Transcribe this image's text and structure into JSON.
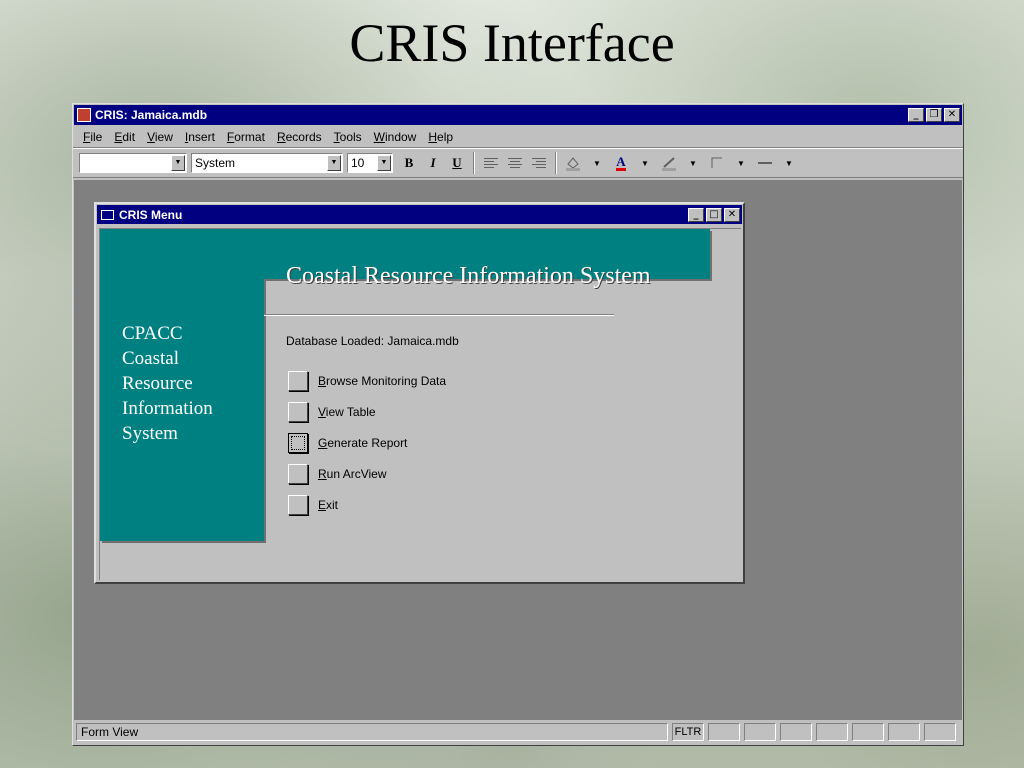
{
  "slide": {
    "title": "CRIS Interface"
  },
  "app": {
    "title": "CRIS: Jamaica.mdb",
    "window_buttons": {
      "minimize": "_",
      "restore": "❒",
      "close": "✕"
    },
    "menu": [
      "File",
      "Edit",
      "View",
      "Insert",
      "Format",
      "Records",
      "Tools",
      "Window",
      "Help"
    ],
    "toolbar": {
      "object_combo": "",
      "font_combo": "System",
      "size_combo": "10",
      "bold": "B",
      "italic": "I",
      "underline": "U",
      "font_color_glyph": "A"
    },
    "status": {
      "text": "Form View",
      "cells": [
        "FLTR",
        "",
        "",
        "",
        "",
        "",
        "",
        ""
      ]
    }
  },
  "form": {
    "title": "CRIS Menu",
    "side_title": [
      "CPACC",
      "Coastal",
      "Resource",
      "Information",
      "System"
    ],
    "banner": "Coastal Resource Information System",
    "db_loaded": "Database Loaded: Jamaica.mdb",
    "buttons": [
      {
        "label": "Browse Monitoring Data",
        "focused": false
      },
      {
        "label": "View Table",
        "focused": false
      },
      {
        "label": "Generate Report",
        "focused": true
      },
      {
        "label": "Run ArcView",
        "focused": false
      },
      {
        "label": "Exit",
        "focused": false
      }
    ],
    "colors": {
      "teal": "#008080",
      "titlebar": "#000080",
      "face": "#c0c0c0",
      "workspace": "#808080"
    }
  }
}
